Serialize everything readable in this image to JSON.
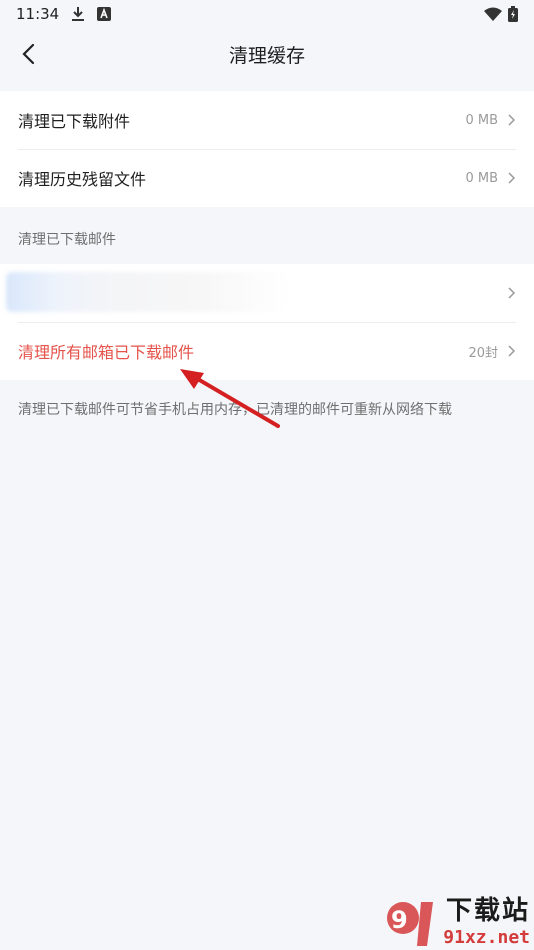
{
  "status_bar": {
    "time": "11:34",
    "icons_left": [
      "download-icon",
      "a-badge-icon"
    ],
    "icons_right": [
      "wifi-icon",
      "battery-icon"
    ]
  },
  "nav": {
    "title": "清理缓存",
    "back_icon": "chevron-left-icon"
  },
  "group1": {
    "items": [
      {
        "label": "清理已下载附件",
        "value": "0 MB"
      },
      {
        "label": "清理历史残留文件",
        "value": "0 MB"
      }
    ]
  },
  "section": {
    "label": "清理已下载邮件"
  },
  "group2": {
    "blurred_account_value": "",
    "clear_all_label": "清理所有邮箱已下载邮件",
    "clear_all_value": "20封"
  },
  "note": {
    "text": "清理已下载邮件可节省手机占用内存，已清理的邮件可重新从网络下载"
  },
  "watermark": {
    "logo_glyph": "91",
    "title": "下载站",
    "subtitle": "91xz.net"
  },
  "colors": {
    "accent_danger": "#e5534b",
    "annotation_arrow": "#d42020",
    "background": "#f5f6fa"
  }
}
